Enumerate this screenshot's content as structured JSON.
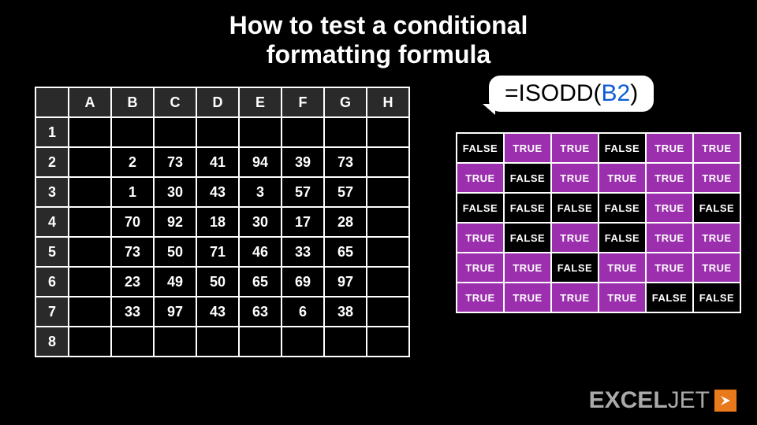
{
  "title_line1": "How to test a conditional",
  "title_line2": "formatting formula",
  "sheet": {
    "cols": [
      "A",
      "B",
      "C",
      "D",
      "E",
      "F",
      "G",
      "H"
    ],
    "rows": [
      "1",
      "2",
      "3",
      "4",
      "5",
      "6",
      "7",
      "8"
    ],
    "data": {
      "2": [
        "",
        "2",
        "73",
        "41",
        "94",
        "39",
        "73",
        ""
      ],
      "3": [
        "",
        "1",
        "30",
        "43",
        "3",
        "57",
        "57",
        ""
      ],
      "4": [
        "",
        "70",
        "92",
        "18",
        "30",
        "17",
        "28",
        ""
      ],
      "5": [
        "",
        "73",
        "50",
        "71",
        "46",
        "33",
        "65",
        ""
      ],
      "6": [
        "",
        "23",
        "49",
        "50",
        "65",
        "69",
        "97",
        ""
      ],
      "7": [
        "",
        "33",
        "97",
        "43",
        "63",
        "6",
        "38",
        ""
      ]
    }
  },
  "formula": {
    "prefix": "=ISODD(",
    "ref": "B2",
    "suffix": ")"
  },
  "results_labels": {
    "true": "TRUE",
    "false": "FALSE"
  },
  "results": [
    [
      false,
      true,
      true,
      false,
      true,
      true
    ],
    [
      true,
      false,
      true,
      true,
      true,
      true
    ],
    [
      false,
      false,
      false,
      false,
      true,
      false
    ],
    [
      true,
      false,
      true,
      false,
      true,
      true
    ],
    [
      true,
      true,
      false,
      true,
      true,
      true
    ],
    [
      true,
      true,
      true,
      true,
      false,
      false
    ]
  ],
  "logo": {
    "word1": "EXCEL",
    "word2": "JET"
  },
  "colors": {
    "highlight": "#9b2fae",
    "accent": "#e87a1c",
    "ref": "#0a5cd6"
  }
}
